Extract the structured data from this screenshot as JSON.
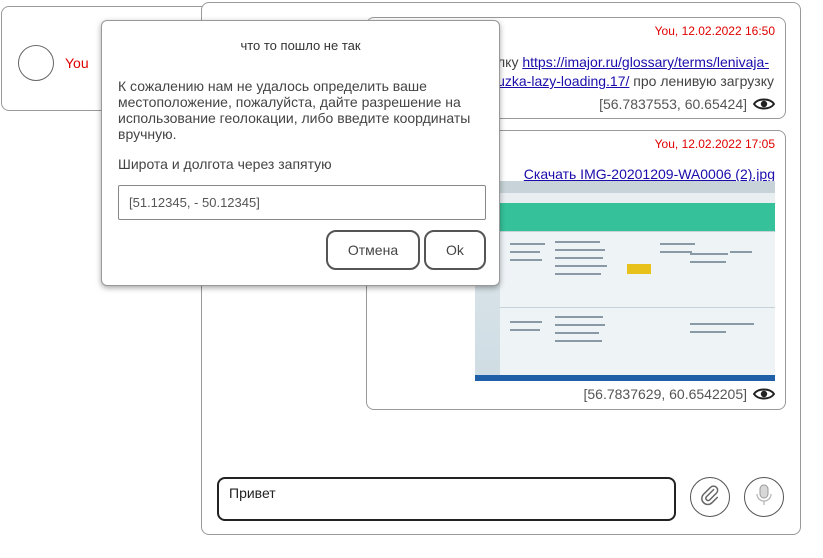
{
  "user": {
    "name": "You"
  },
  "messages": [
    {
      "header": "You, 12.02.2022 16:50",
      "text_prefix": "лку ",
      "link_part1": "https://imajor.ru/glossary/terms/lenivaja-",
      "link_part2": "zuzka-lazy-loading.17/",
      "text_suffix": " про ленивую загрузку",
      "coords": "[56.7837553, 60.65424]"
    },
    {
      "header": "You, 12.02.2022 17:05",
      "file_link": "Скачать IMG-20201209-WA0006 (2).jpg",
      "coords": "[56.7837629, 60.6542205]"
    }
  ],
  "compose": {
    "value": "Привет"
  },
  "icons": {
    "coords_view": "eye-icon",
    "attach": "paperclip-icon",
    "mic": "microphone-icon"
  },
  "dialog": {
    "title": "что то пошло не так",
    "message": "К сожалению нам не удалось определить ваше местоположение, пожалуйста, дайте разрешение на использование геолокации, либо введите координаты вручную.",
    "prompt": "Широта и долгота через запятую",
    "input_value": "[51.12345, - 50.12345]",
    "cancel_label": "Отмена",
    "ok_label": "Ok"
  },
  "colors": {
    "author": "#e00000",
    "link": "#1a0dab",
    "border": "#999999"
  }
}
